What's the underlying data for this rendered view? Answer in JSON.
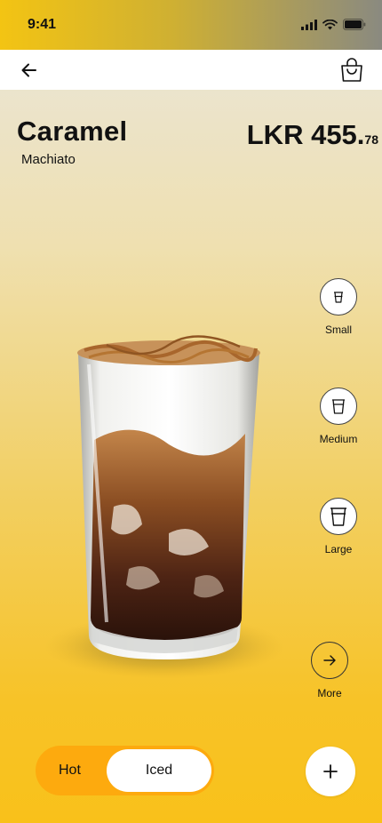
{
  "status_bar": {
    "time": "9:41"
  },
  "product": {
    "name": "Caramel",
    "variant": "Machiato",
    "price_main": "LKR 455.",
    "price_cents": "78"
  },
  "sizes": [
    {
      "label": "Small",
      "icon": "small-cup-icon"
    },
    {
      "label": "Medium",
      "icon": "medium-cup-icon"
    },
    {
      "label": "Large",
      "icon": "large-cup-icon"
    }
  ],
  "more": {
    "label": "More",
    "icon": "arrow-right-icon"
  },
  "temperature": {
    "hot_label": "Hot",
    "iced_label": "Iced",
    "selected": "Iced"
  },
  "icons": {
    "back": "arrow-left-icon",
    "bag": "shopping-bag-icon",
    "add": "plus-icon"
  },
  "colors": {
    "accent": "#fdaa0e",
    "background_bottom": "#f9c11a"
  }
}
